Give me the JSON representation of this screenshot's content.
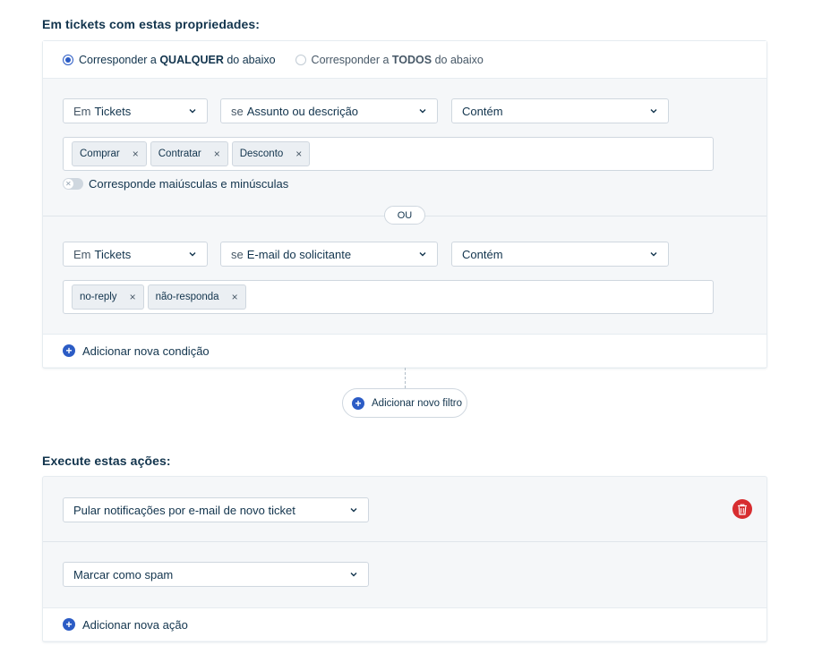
{
  "conditions": {
    "title": "Em tickets com estas propriedades:",
    "match_any": {
      "pre": "Corresponder a ",
      "bold": "QUALQUER",
      "post": " do abaixo"
    },
    "match_all": {
      "pre": "Corresponder a ",
      "bold": "TODOS",
      "post": " do abaixo"
    },
    "rows": [
      {
        "in_prefix": "Em",
        "in_value": "Tickets",
        "field_prefix": "se",
        "field_value": "Assunto ou descrição",
        "operator": "Contém",
        "tags": [
          "Comprar",
          "Contratar",
          "Desconto"
        ],
        "case_label": "Corresponde maiúsculas e minúsculas"
      },
      {
        "in_prefix": "Em",
        "in_value": "Tickets",
        "field_prefix": "se",
        "field_value": "E-mail do solicitante",
        "operator": "Contém",
        "tags": [
          "no-reply",
          "não-responda"
        ]
      }
    ],
    "or_label": "OU",
    "add_condition": "Adicionar nova condição",
    "add_filter": "Adicionar novo filtro"
  },
  "actions": {
    "title": "Execute estas ações:",
    "items": [
      "Pular notificações por e-mail de novo ticket",
      "Marcar como spam"
    ],
    "add_action": "Adicionar nova ação"
  },
  "icons": {
    "add": "plus-circle-icon",
    "delete": "trash-icon",
    "dropdown": "chevron-down-icon",
    "remove": "close-icon"
  },
  "colors": {
    "accent": "#2c5cc5",
    "danger": "#d72d30",
    "text": "#12344d"
  }
}
